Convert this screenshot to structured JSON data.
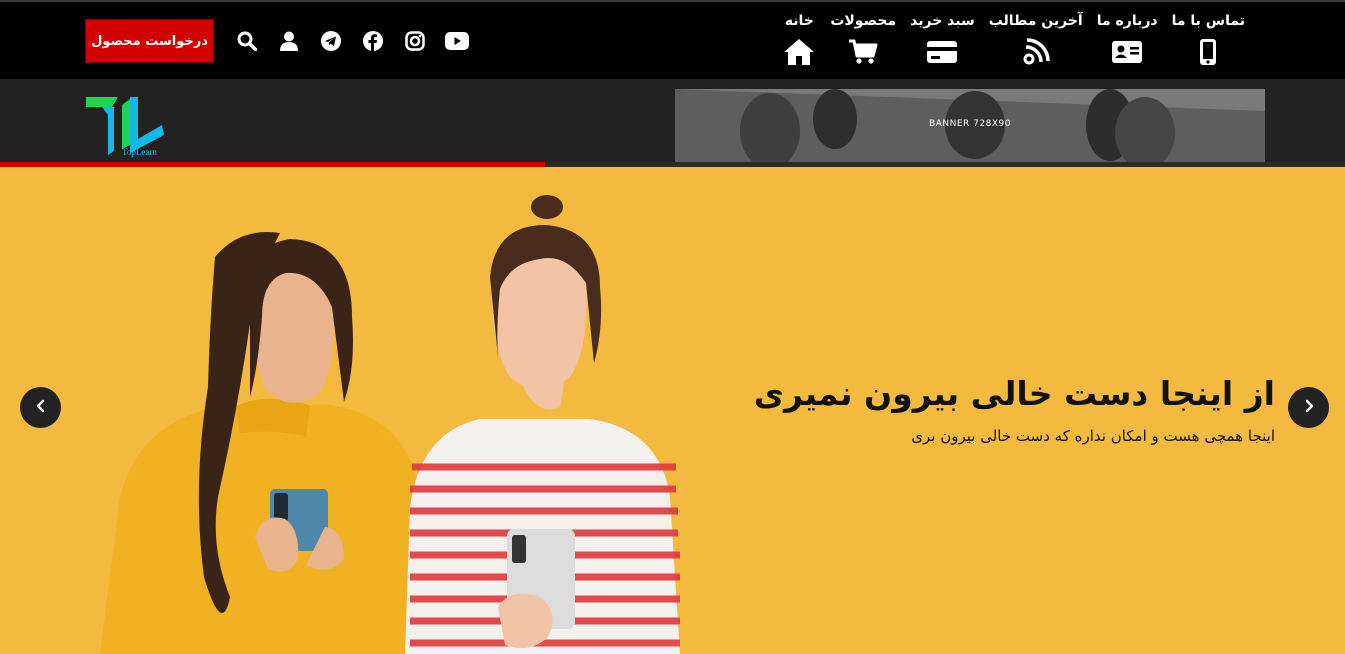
{
  "nav": {
    "items": [
      {
        "label": "خانه",
        "icon": "home-icon"
      },
      {
        "label": "محصولات",
        "icon": "cart-icon"
      },
      {
        "label": "سبد خرید",
        "icon": "credit-card-icon"
      },
      {
        "label": "آخرین مطالب",
        "icon": "feed-icon"
      },
      {
        "label": "درباره ما",
        "icon": "id-card-icon"
      },
      {
        "label": "تماس با ما",
        "icon": "mobile-icon"
      }
    ]
  },
  "toolbar": {
    "request_label": "درخواست محصول",
    "icons": [
      "search-icon",
      "user-icon",
      "telegram-icon",
      "facebook-icon",
      "instagram-icon",
      "youtube-icon"
    ]
  },
  "logo": {
    "brand": "TopLearn"
  },
  "banner": {
    "label": "BANNER 728X90"
  },
  "progress": {
    "fraction": 0.405
  },
  "hero": {
    "title": "از اینجا دست خالی بیرون نمیری",
    "subtitle": "اینجا همچی هست و امکان نداره که دست خالی بیرون بری"
  },
  "colors": {
    "accent": "#d30000",
    "hero_bg": "#f4ba3f",
    "band": "#222222"
  }
}
